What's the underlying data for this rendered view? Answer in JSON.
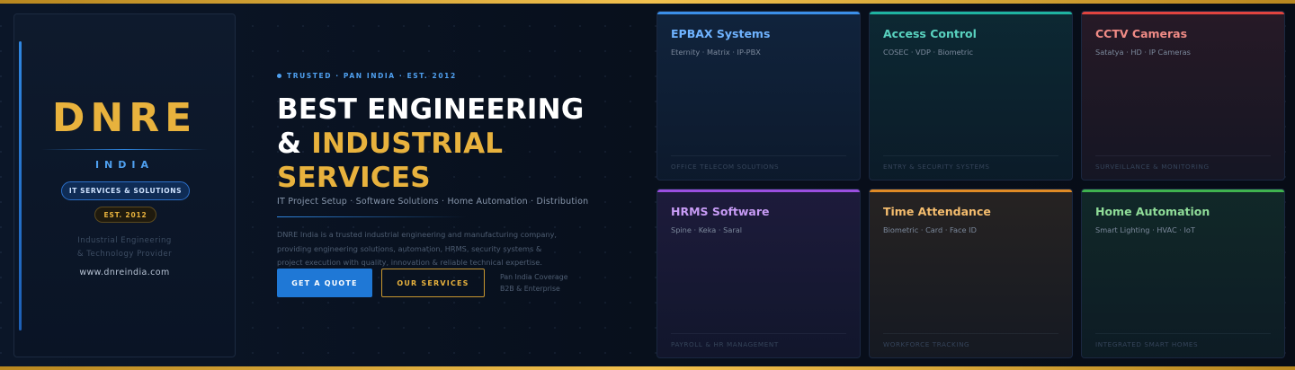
{
  "brand": {
    "logo": "DNRE",
    "country": "INDIA",
    "pill": "IT SERVICES & SOLUTIONS",
    "est": "EST. 2012",
    "tagline_line1": "Industrial Engineering",
    "tagline_line2": "& Technology Provider",
    "url": "www.dnreindia.com"
  },
  "hero": {
    "eyebrow": "TRUSTED · PAN INDIA · EST. 2012",
    "headline_line1": "BEST ENGINEERING",
    "headline_amp": "& ",
    "headline_gold": "INDUSTRIAL SERVICES",
    "subheading": "IT Project Setup · Software Solutions · Home Automation · Distribution",
    "description": "DNRE India is a trusted industrial engineering and manufacturing company, providing engineering solutions, automation, HRMS, security systems & project execution with quality, innovation & reliable technical expertise.",
    "primary_cta": "GET A QUOTE",
    "secondary_cta": "OUR SERVICES",
    "coverage_line1": "Pan India Coverage",
    "coverage_line2": "B2B & Enterprise"
  },
  "services": [
    {
      "title": "EPBAX Systems",
      "desc": "Eternity · Matrix · IP-PBX",
      "footer": "OFFICE TELECOM SOLUTIONS",
      "accent": "#3b8fe8",
      "title_color": "#6fb3ff"
    },
    {
      "title": "Access Control",
      "desc": "COSEC · VDP · Biometric",
      "footer": "ENTRY & SECURITY SYSTEMS",
      "accent": "#1fb3a0",
      "title_color": "#59d2bf"
    },
    {
      "title": "CCTV Cameras",
      "desc": "Satatya · HD · IP Cameras",
      "footer": "SURVEILLANCE & MONITORING",
      "accent": "#e0443f",
      "title_color": "#f08b86"
    },
    {
      "title": "HRMS Software",
      "desc": "Spine · Keka · Saral",
      "footer": "PAYROLL & HR MANAGEMENT",
      "accent": "#9a4fe0",
      "title_color": "#c79bf5"
    },
    {
      "title": "Time Attendance",
      "desc": "Biometric · Card · Face ID",
      "footer": "WORKFORCE TRACKING",
      "accent": "#e08a25",
      "title_color": "#f5bd6e"
    },
    {
      "title": "Home Automation",
      "desc": "Smart Lighting · HVAC · IoT",
      "footer": "INTEGRATED SMART HOMES",
      "accent": "#3fb34f",
      "title_color": "#8fdc98"
    }
  ]
}
